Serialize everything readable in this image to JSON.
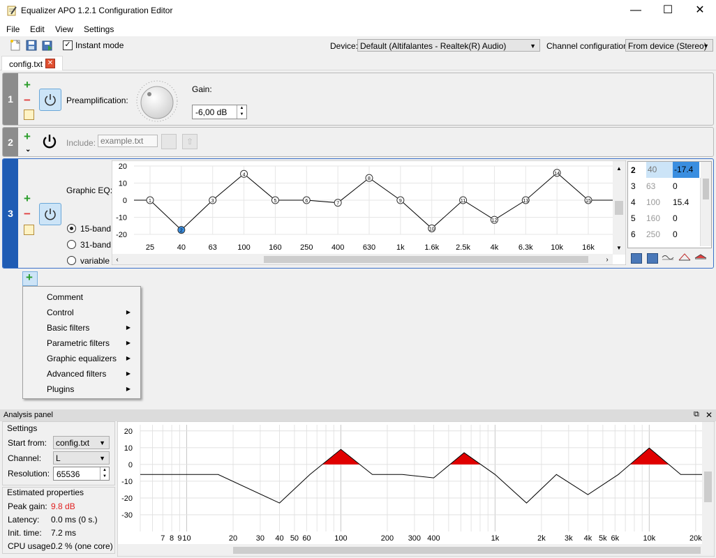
{
  "window": {
    "title": "Equalizer APO 1.2.1 Configuration Editor",
    "min": "—",
    "max": "☐",
    "close": "✕"
  },
  "menu": [
    "File",
    "Edit",
    "View",
    "Settings"
  ],
  "toolbar": {
    "instant_mode": "Instant mode",
    "device_label": "Device:",
    "device_value": "Default (Altifalantes - Realtek(R) Audio)",
    "channel_label": "Channel configuration:",
    "channel_value": "From device (Stereo)"
  },
  "tab": {
    "label": "config.txt"
  },
  "rows": [
    {
      "num": "1",
      "label": "Preamplification:",
      "gain_label": "Gain:",
      "gain_value": "-6,00 dB"
    },
    {
      "num": "2",
      "label": "Include:",
      "placeholder": "example.txt"
    },
    {
      "num": "3",
      "label": "Graphic EQ:",
      "modes": [
        "15-band",
        "31-band",
        "variable"
      ]
    }
  ],
  "eq_chart": {
    "y_ticks": [
      "20",
      "10",
      "0",
      "-10",
      "-20"
    ],
    "x_ticks": [
      "25",
      "40",
      "63",
      "100",
      "160",
      "250",
      "400",
      "630",
      "1k",
      "1.6k",
      "2.5k",
      "4k",
      "6.3k",
      "10k",
      "16k"
    ],
    "points": [
      {
        "n": "1",
        "v": 0
      },
      {
        "n": "2",
        "v": -17.4
      },
      {
        "n": "3",
        "v": 0
      },
      {
        "n": "4",
        "v": 15.4
      },
      {
        "n": "5",
        "v": 0
      },
      {
        "n": "6",
        "v": 0
      },
      {
        "n": "7",
        "v": -1.5
      },
      {
        "n": "8",
        "v": 13
      },
      {
        "n": "9",
        "v": 0
      },
      {
        "n": "10",
        "v": -16.5
      },
      {
        "n": "11",
        "v": 0
      },
      {
        "n": "12",
        "v": -11.5
      },
      {
        "n": "13",
        "v": 0
      },
      {
        "n": "14",
        "v": 16
      },
      {
        "n": "15",
        "v": 0
      }
    ]
  },
  "band_table": [
    {
      "n": "2",
      "f": "40",
      "g": "-17.4"
    },
    {
      "n": "3",
      "f": "63",
      "g": "0"
    },
    {
      "n": "4",
      "f": "100",
      "g": "15.4"
    },
    {
      "n": "5",
      "f": "160",
      "g": "0"
    },
    {
      "n": "6",
      "f": "250",
      "g": "0"
    }
  ],
  "context_menu": [
    {
      "label": "Comment",
      "sub": false
    },
    {
      "label": "Control",
      "sub": true
    },
    {
      "label": "Basic filters",
      "sub": true
    },
    {
      "label": "Parametric filters",
      "sub": true
    },
    {
      "label": "Graphic equalizers",
      "sub": true
    },
    {
      "label": "Advanced filters",
      "sub": true
    },
    {
      "label": "Plugins",
      "sub": true
    }
  ],
  "analysis": {
    "title": "Analysis panel",
    "settings": "Settings",
    "start_label": "Start from:",
    "start_value": "config.txt",
    "channel_label": "Channel:",
    "channel_value": "L",
    "resolution_label": "Resolution:",
    "resolution_value": "65536",
    "est": "Estimated properties",
    "peak_label": "Peak gain:",
    "peak_value": "9.8 dB",
    "peak_color": "#e02020",
    "latency_label": "Latency:",
    "latency_value": "0.0 ms (0 s.)",
    "init_label": "Init. time:",
    "init_value": "7.2 ms",
    "cpu_label": "CPU usage:",
    "cpu_value": "0.2 % (one core)"
  },
  "chart_data": {
    "type": "line",
    "title": "",
    "y_ticks": [
      "20",
      "10",
      "0",
      "-10",
      "-20",
      "-30"
    ],
    "ylim": [
      -35,
      22
    ],
    "x_tick_labels": [
      "7",
      "8",
      "9",
      "10",
      "20",
      "30",
      "40",
      "50",
      "60",
      "100",
      "200",
      "300",
      "400",
      "1k",
      "2k",
      "3k",
      "4k",
      "5k",
      "6k",
      "10k",
      "20k"
    ],
    "x": [
      5,
      16,
      40,
      63,
      100,
      160,
      250,
      400,
      630,
      1000,
      1600,
      2500,
      4000,
      6300,
      10000,
      16000,
      22000
    ],
    "y": [
      -6,
      -6,
      -23,
      -6,
      9,
      -6,
      -6,
      -8,
      7,
      -6,
      -23,
      -6,
      -18,
      -6,
      9.8,
      -6,
      -6
    ],
    "clip_level": 0,
    "clip_color": "#e00000"
  }
}
